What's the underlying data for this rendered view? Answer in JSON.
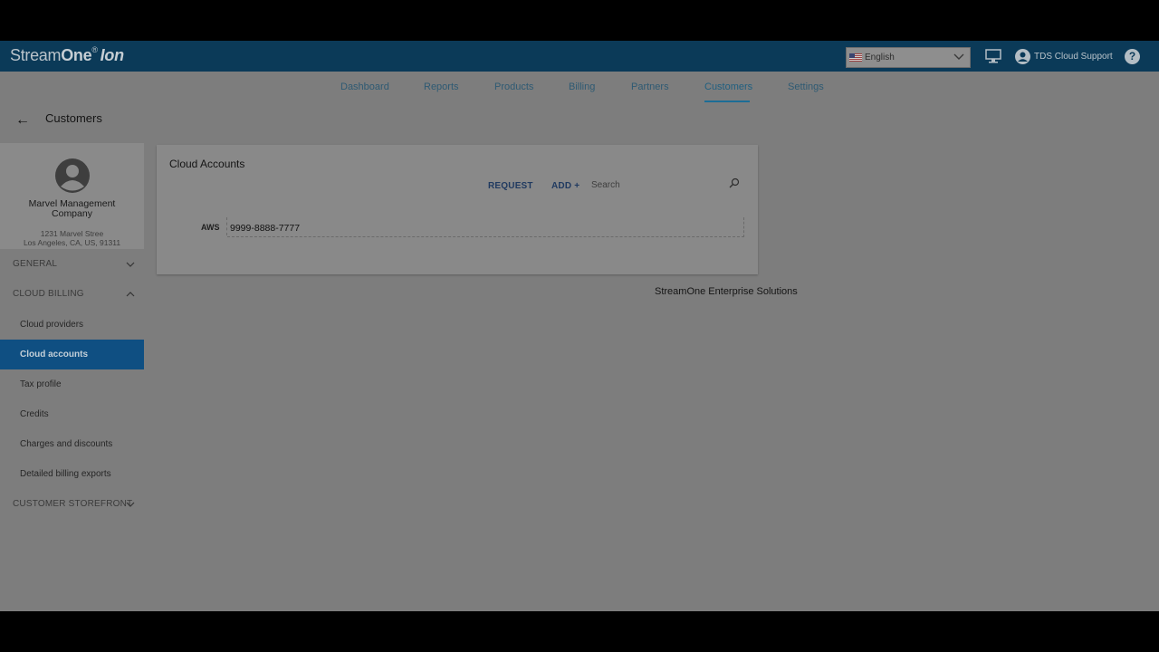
{
  "header": {
    "brand_main": "Stream",
    "brand_one": "One",
    "brand_reg": "®",
    "brand_ion": "Ion",
    "language": "English",
    "user_name": "TDS Cloud Support",
    "help_glyph": "?"
  },
  "nav": {
    "items": [
      "Dashboard",
      "Reports",
      "Products",
      "Billing",
      "Partners",
      "Customers",
      "Settings"
    ],
    "active": "Customers"
  },
  "page": {
    "back_glyph": "←",
    "title": "Customers"
  },
  "profile": {
    "company_name": "Marvel Management Company",
    "address_line1": "1231 Marvel Stree",
    "address_line2": "Los Angeles, CA, US, 91311"
  },
  "sidebar": {
    "general": "GENERAL",
    "cloud_billing": "CLOUD BILLING",
    "items": [
      "Cloud providers",
      "Cloud accounts",
      "Tax profile",
      "Credits",
      "Charges and discounts",
      "Detailed billing exports"
    ],
    "active_item": "Cloud accounts",
    "customer_storefront": "CUSTOMER STOREFRONT"
  },
  "card": {
    "title": "Cloud Accounts",
    "request_label": "REQUEST",
    "add_label": "ADD +",
    "search_placeholder": "Search",
    "accounts": [
      {
        "provider": "AWS",
        "account_id": "9999-8888-7777"
      }
    ]
  },
  "footer": {
    "text": "StreamOne Enterprise Solutions"
  },
  "colors": {
    "header_bg": "#0b3a58",
    "active_item_bg": "#0f4f82",
    "overlay_bg": "#7d7d7d"
  }
}
